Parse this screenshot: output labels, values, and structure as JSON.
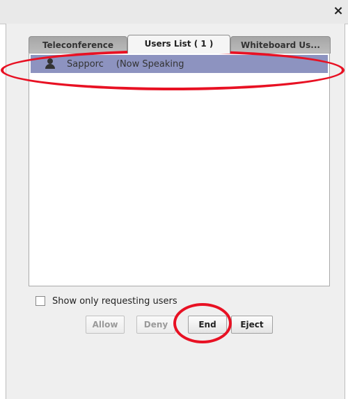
{
  "window": {
    "close_glyph": "×"
  },
  "tabs": [
    {
      "label": "Teleconference",
      "active": false
    },
    {
      "label": "Users List ( 1 )",
      "active": true
    },
    {
      "label": "Whiteboard Us...",
      "active": false
    }
  ],
  "users": [
    {
      "name": "Sapporc",
      "status": "(Now Speaking",
      "icon": "user-icon",
      "selected": true
    }
  ],
  "filter": {
    "label": "Show only requesting users",
    "checked": false
  },
  "buttons": {
    "allow": {
      "label": "Allow",
      "enabled": false
    },
    "deny": {
      "label": "Deny",
      "enabled": false
    },
    "end": {
      "label": "End",
      "enabled": true
    },
    "eject": {
      "label": "Eject",
      "enabled": true
    }
  },
  "colors": {
    "selection": "#8d93c0",
    "highlight_annotation": "#e81123"
  }
}
